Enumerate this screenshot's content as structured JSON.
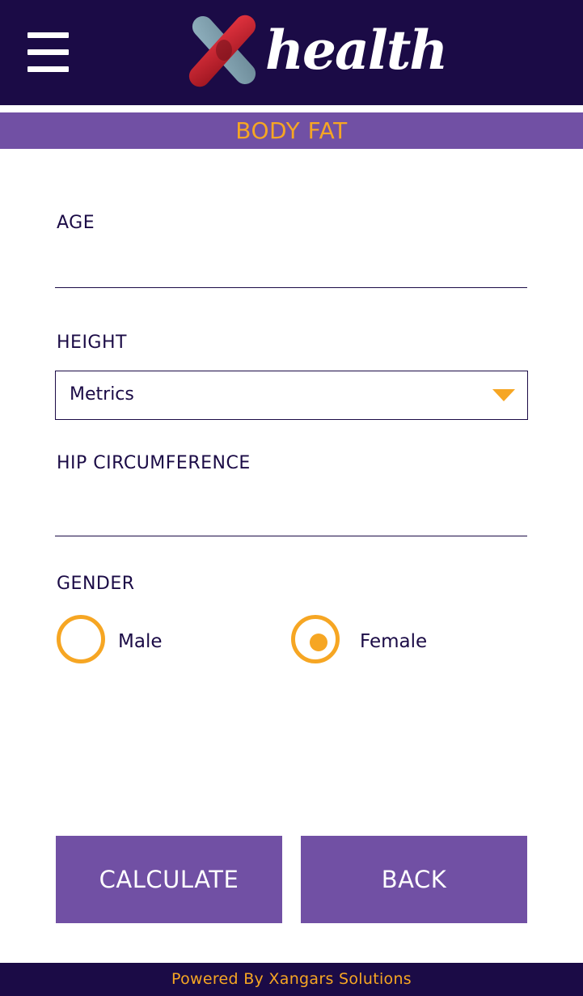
{
  "header": {
    "logo_text": "health",
    "logo_mark": "X",
    "menu_icon": "hamburger-menu-icon"
  },
  "section": {
    "title": "BODY FAT"
  },
  "form": {
    "age": {
      "label": "AGE",
      "value": ""
    },
    "height": {
      "label": "HEIGHT",
      "selected": "Metrics",
      "caret_icon": "chevron-down-icon"
    },
    "hip": {
      "label": "HIP CIRCUMFERENCE",
      "value": ""
    },
    "gender": {
      "label": "GENDER",
      "options": [
        {
          "label": "Male",
          "selected": false
        },
        {
          "label": "Female",
          "selected": true
        }
      ]
    }
  },
  "actions": {
    "calculate_label": "CALCULATE",
    "back_label": "BACK"
  },
  "footer": {
    "text": "Powered By Xangars Solutions"
  },
  "colors": {
    "navy": "#1b0b46",
    "purple": "#7150a4",
    "orange": "#f6a623",
    "logo_red": "#d4202e",
    "logo_steel": "#7d9cab"
  }
}
